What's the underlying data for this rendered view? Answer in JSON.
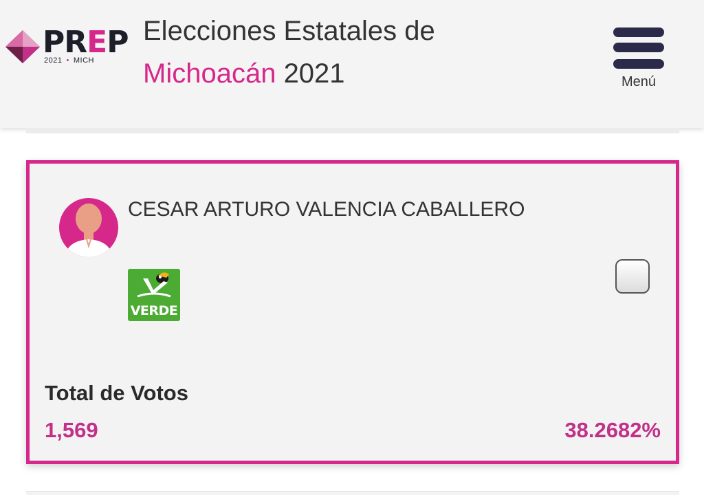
{
  "header": {
    "logo": {
      "wordmark_p": "PR",
      "wordmark_e": "E",
      "wordmark_end": "P",
      "year": "2021",
      "state": "MICH"
    },
    "title_line1": "Elecciones Estatales de",
    "title_highlight": "Michoacán",
    "title_year": "2021",
    "menu_label": "Menú"
  },
  "candidate_card": {
    "candidate_name": "CESAR ARTURO VALENCIA CABALLERO",
    "party": {
      "logo_text": "VERDE",
      "color": "#4bab33"
    },
    "selected": false,
    "votes_label": "Total de Votos",
    "votes_value": "1,569",
    "votes_percent": "38.2682%"
  },
  "colors": {
    "accent": "#d6278b",
    "text_dark": "#333333",
    "navy": "#2c2a4a"
  }
}
